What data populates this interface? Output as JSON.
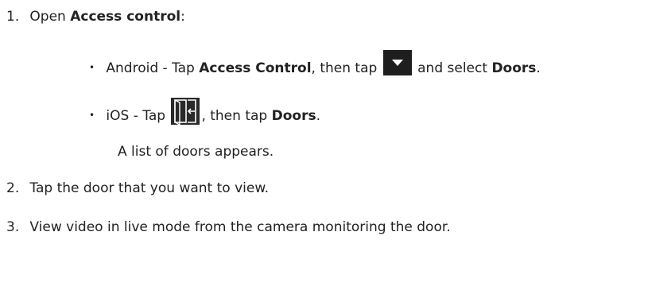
{
  "steps": [
    {
      "number": "1.",
      "pre": "Open ",
      "bold": "Access control",
      "post": ":"
    },
    {
      "number": "2.",
      "text": "Tap the door that you want to view."
    },
    {
      "number": "3.",
      "text": "View video in live mode from the camera monitoring the door."
    }
  ],
  "android": {
    "bullet": "•",
    "pre": "Android - Tap ",
    "bold1": "Access Control",
    "mid": ", then tap ",
    "icon": "dropdown-arrow-icon",
    "post": " and select ",
    "bold2": "Doors",
    "end": "."
  },
  "ios": {
    "bullet": "•",
    "pre": "iOS - Tap ",
    "icon": "door-enter-icon",
    "mid": ", then tap ",
    "bold": "Doors",
    "end": "."
  },
  "note": "A list of doors appears.",
  "colors": {
    "text": "#222222",
    "icon_bg": "#1e1e1e"
  }
}
